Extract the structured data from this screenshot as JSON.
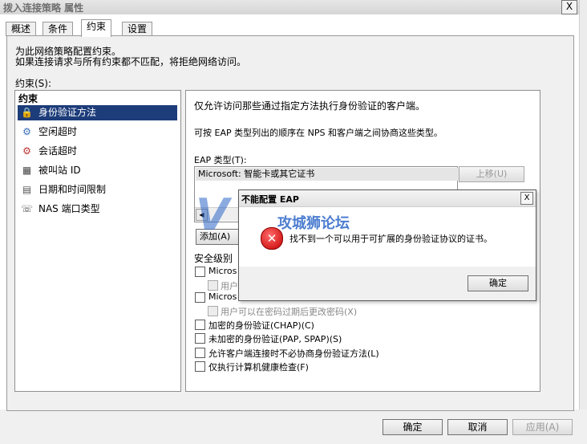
{
  "window": {
    "title": "拨入连接策略 属性",
    "close_glyph": "X"
  },
  "tabs": [
    {
      "label": "概述"
    },
    {
      "label": "条件"
    },
    {
      "label": "约束"
    },
    {
      "label": "设置"
    }
  ],
  "description": {
    "line1": "为此网络策略配置约束。",
    "line2": "如果连接请求与所有约束都不匹配，将拒绝网络访问。"
  },
  "constraints_label": "约束(S):",
  "constraints": {
    "header": "约束",
    "items": [
      {
        "label": "身份验证方法",
        "icon": "lock-icon",
        "glyph": "🔒"
      },
      {
        "label": "空闲超时",
        "icon": "idle-icon",
        "glyph": "⚙"
      },
      {
        "label": "会话超时",
        "icon": "session-icon",
        "glyph": "⚙"
      },
      {
        "label": "被叫站 ID",
        "icon": "station-icon",
        "glyph": "▦"
      },
      {
        "label": "日期和时间限制",
        "icon": "calendar-icon",
        "glyph": "▤"
      },
      {
        "label": "NAS 端口类型",
        "icon": "nas-icon",
        "glyph": "☏"
      }
    ]
  },
  "auth": {
    "intro": "仅允许访问那些通过指定方法执行身份验证的客户端。",
    "order_note": "可按 EAP 类型列出的顺序在 NPS 和客户端之间协商这些类型。",
    "eap_label": "EAP 类型(T):",
    "eap_items": [
      "Microsoft: 智能卡或其它证书"
    ],
    "move_up": "上移(U)",
    "add": "添加(A)",
    "secure_label": "安全级别",
    "ms_trunc1": "Micros",
    "user_trunc": "用户",
    "ms_trunc2": "Micros",
    "pw_expired": "用户可以在密码过期后更改密码(X)",
    "chap": "加密的身份验证(CHAP)(C)",
    "pap": "未加密的身份验证(PAP, SPAP)(S)",
    "no_negotiate": "允许客户端连接时不必协商身份验证方法(L)",
    "health_only": "仅执行计算机健康检查(F)"
  },
  "dialog": {
    "title": "不能配置 EAP",
    "message": "找不到一个可以用于可扩展的身份验证协议的证书。",
    "ok": "确定",
    "close_glyph": "X"
  },
  "watermark": {
    "text": "攻城狮论坛",
    "glyph": "V"
  },
  "footer": {
    "ok": "确定",
    "cancel": "取消",
    "apply": "应用(A)"
  }
}
